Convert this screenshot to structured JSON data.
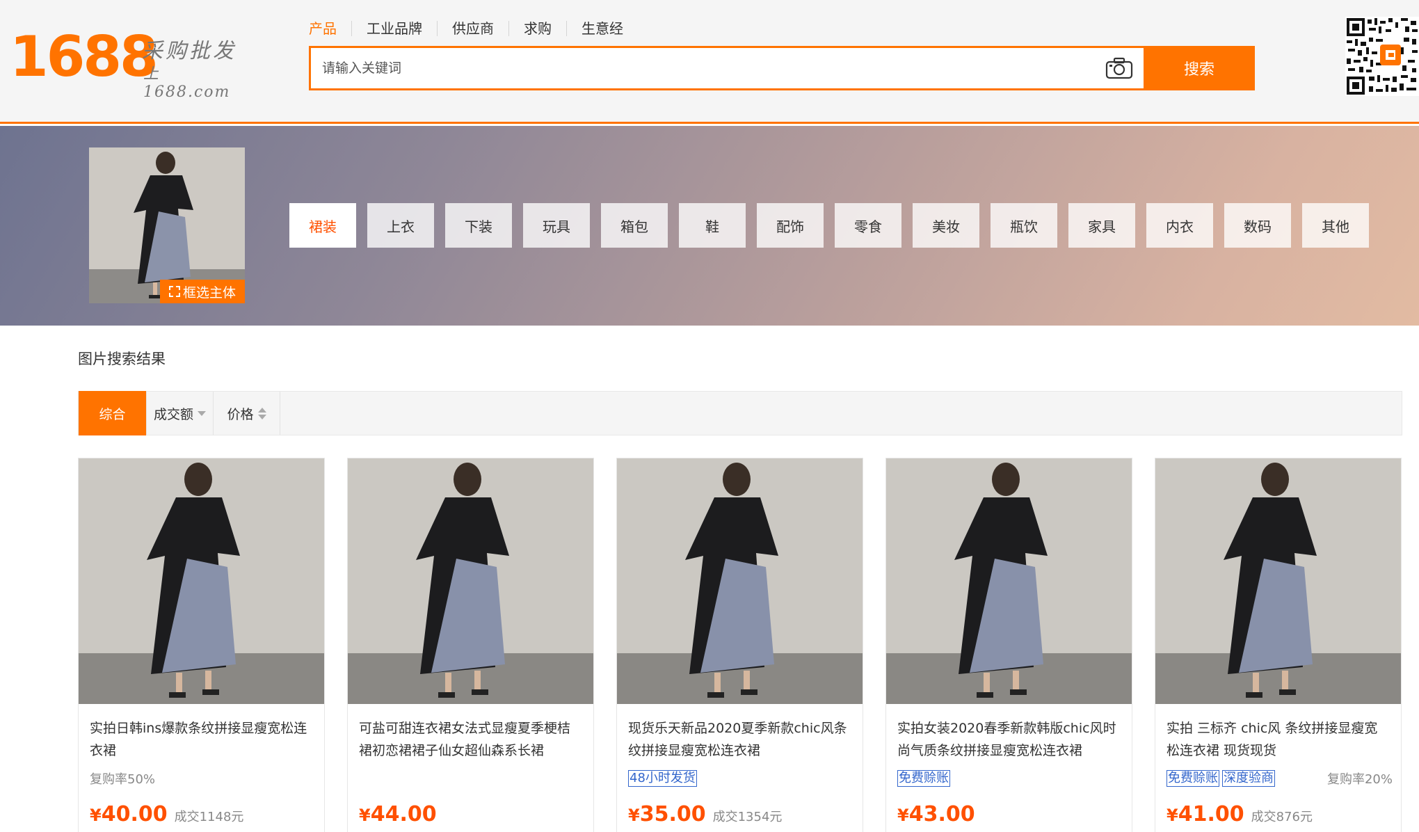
{
  "logo": {
    "number": "1688",
    "tagline_1": "采购批发",
    "tagline_2": "上 1688.com"
  },
  "nav": {
    "items": [
      "产品",
      "工业品牌",
      "供应商",
      "求购",
      "生意经"
    ],
    "active_index": 0
  },
  "search": {
    "placeholder": "请输入关键词",
    "button_label": "搜索"
  },
  "colors": {
    "brand": "#ff7300",
    "price": "#ff5000",
    "tag_blue": "#3366cc"
  },
  "icons": {
    "camera": "camera-icon",
    "crop": "crop-select-icon",
    "qr": "qr-code-icon"
  },
  "banner": {
    "select_subject_label": "框选主体",
    "categories": [
      "裙装",
      "上衣",
      "下装",
      "玩具",
      "箱包",
      "鞋",
      "配饰",
      "零食",
      "美妆",
      "瓶饮",
      "家具",
      "内衣",
      "数码",
      "其他"
    ],
    "active_category": 0
  },
  "results": {
    "title": "图片搜索结果",
    "sort": {
      "overall": "综合",
      "deal_amount": "成交额",
      "price": "价格"
    },
    "products": [
      {
        "title": "实拍日韩ins爆款条纹拼接显瘦宽松连衣裙",
        "tags": [],
        "repurchase": "复购率50%",
        "currency": "¥",
        "price": "40.00",
        "deal": "成交1148元"
      },
      {
        "title": "可盐可甜连衣裙女法式显瘦夏季梗桔裙初恋裙裙子仙女超仙森系长裙",
        "tags": [],
        "repurchase": "",
        "currency": "¥",
        "price": "44.00",
        "deal": ""
      },
      {
        "title": "现货乐天新品2020夏季新款chic风条纹拼接显瘦宽松连衣裙",
        "tags": [
          "48小时发货"
        ],
        "repurchase": "",
        "currency": "¥",
        "price": "35.00",
        "deal": "成交1354元"
      },
      {
        "title": "实拍女装2020春季新款韩版chic风时尚气质条纹拼接显瘦宽松连衣裙",
        "tags": [
          "免费赊账"
        ],
        "repurchase": "",
        "currency": "¥",
        "price": "43.00",
        "deal": ""
      },
      {
        "title": "实拍 三标齐 chic风 条纹拼接显瘦宽松连衣裙 现货现货",
        "tags": [
          "免费赊账",
          "深度验商"
        ],
        "repurchase": "复购率20%",
        "currency": "¥",
        "price": "41.00",
        "deal": "成交876元"
      }
    ]
  }
}
